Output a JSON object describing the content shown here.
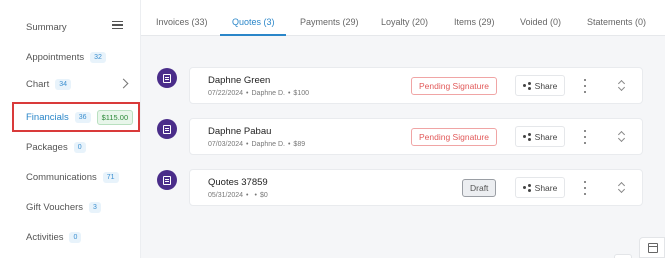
{
  "sidebar": {
    "header": "Summary",
    "items": [
      {
        "label": "Appointments",
        "count": "32"
      },
      {
        "label": "Chart",
        "count": "34"
      },
      {
        "label": "Financials",
        "count": "36",
        "amount": "$115.00"
      },
      {
        "label": "Packages",
        "count": "0"
      },
      {
        "label": "Communications",
        "count": "71"
      },
      {
        "label": "Gift Vouchers",
        "count": "3"
      },
      {
        "label": "Activities",
        "count": "0"
      }
    ]
  },
  "tabs": [
    {
      "label": "Invoices (33)"
    },
    {
      "label": "Quotes (3)"
    },
    {
      "label": "Payments (29)"
    },
    {
      "label": "Loyalty (20)"
    },
    {
      "label": "Items (29)"
    },
    {
      "label": "Voided (0)"
    },
    {
      "label": "Statements (0)"
    }
  ],
  "quotes": [
    {
      "name": "Daphne Green",
      "date": "07/22/2024",
      "staff": "Daphne D.",
      "amount": "$100",
      "status": "Pending Signature",
      "share": "Share"
    },
    {
      "name": "Daphne Pabau",
      "date": "07/03/2024",
      "staff": "Daphne D.",
      "amount": "$89",
      "status": "Pending Signature",
      "share": "Share"
    },
    {
      "name": "Quotes 37859",
      "date": "05/31/2024",
      "staff": "",
      "amount": "$0",
      "status": "Draft",
      "share": "Share"
    }
  ],
  "separator": "•",
  "colors": {
    "accent": "#2a86c9",
    "avatar": "#4a2d8a",
    "pending": "#e25a5a",
    "highlight": "#d93a3a"
  },
  "icons": [
    "menu-icon",
    "chevron-right-icon",
    "quote-document-icon",
    "share-icon",
    "kebab-menu-icon",
    "sort-icon",
    "calendar-icon"
  ]
}
